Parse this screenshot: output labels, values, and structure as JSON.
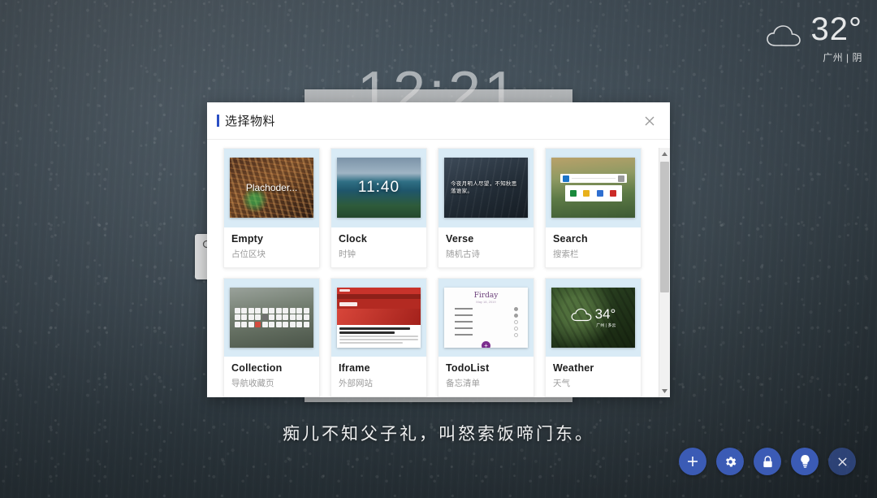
{
  "desktop": {
    "clock_time": "12:21",
    "weather": {
      "icon": "cloud-icon",
      "temperature": "32°",
      "location_condition": "广州 | 阴"
    },
    "verse_line": "痴儿不知父子礼，叫怒索饭啼门东。",
    "search_icon": "search-icon",
    "panel": {
      "cancel_label": "",
      "confirm_label": ""
    },
    "toolbar": [
      {
        "name": "add-button",
        "glyph": "+"
      },
      {
        "name": "settings-button",
        "glyph": "gear"
      },
      {
        "name": "lock-button",
        "glyph": "lock"
      },
      {
        "name": "idea-button",
        "glyph": "bulb"
      },
      {
        "name": "close-button",
        "glyph": "×"
      }
    ],
    "accent_color": "#3b5bb5"
  },
  "modal": {
    "title": "选择物料",
    "close_icon": "close-icon",
    "accent_bar_color": "#2b4fc4",
    "thumb_bg_color": "#d9ebf6",
    "cards": [
      {
        "title": "Empty",
        "subtitle": "占位区块",
        "thumb_kind": "t-empty",
        "thumb_text": "Plachoder..."
      },
      {
        "title": "Clock",
        "subtitle": "时钟",
        "thumb_kind": "t-clock",
        "thumb_text": "11:40"
      },
      {
        "title": "Verse",
        "subtitle": "随机古诗",
        "thumb_kind": "t-verse",
        "thumb_text": "今夜月明人尽望，不知秋思落谁家。"
      },
      {
        "title": "Search",
        "subtitle": "搜索栏",
        "thumb_kind": "t-search",
        "thumb_text": ""
      },
      {
        "title": "Collection",
        "subtitle": "导航收藏页",
        "thumb_kind": "t-collection",
        "thumb_text": ""
      },
      {
        "title": "Iframe",
        "subtitle": "外部网站",
        "thumb_kind": "t-iframe",
        "thumb_text": ""
      },
      {
        "title": "TodoList",
        "subtitle": "备忘清单",
        "thumb_kind": "t-todo",
        "thumb_text": "Firday"
      },
      {
        "title": "Weather",
        "subtitle": "天气",
        "thumb_kind": "t-weather",
        "thumb_text": "34°",
        "thumb_sub": "广州 | 多云"
      }
    ],
    "scrollbar": {
      "up_arrow": "chevron-up-icon",
      "down_arrow": "chevron-down-icon"
    }
  }
}
